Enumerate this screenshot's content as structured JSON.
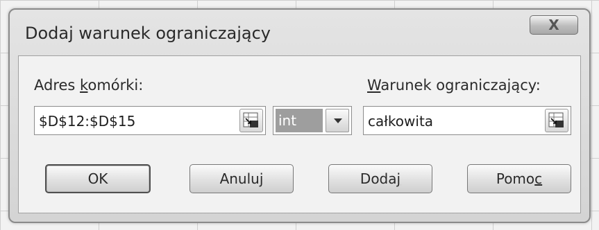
{
  "dialog": {
    "title": "Dodaj warunek ograniczający",
    "close_label": "X"
  },
  "cell_ref": {
    "label_before": "Adres ",
    "label_accel": "k",
    "label_after": "omórki:",
    "value": "$D$12:$D$15"
  },
  "operator": {
    "selected": "int"
  },
  "constraint": {
    "label_accel": "W",
    "label_after": "arunek ograniczający:",
    "value": "całkowita"
  },
  "buttons": {
    "ok": "OK",
    "cancel": "Anuluj",
    "add_before": "Doda",
    "add_accel": "j",
    "help_before": "Pomo",
    "help_accel": "c"
  },
  "icons": {
    "collapse": "range-select-icon",
    "dropdown": "chevron-down-icon",
    "close": "close-icon"
  }
}
